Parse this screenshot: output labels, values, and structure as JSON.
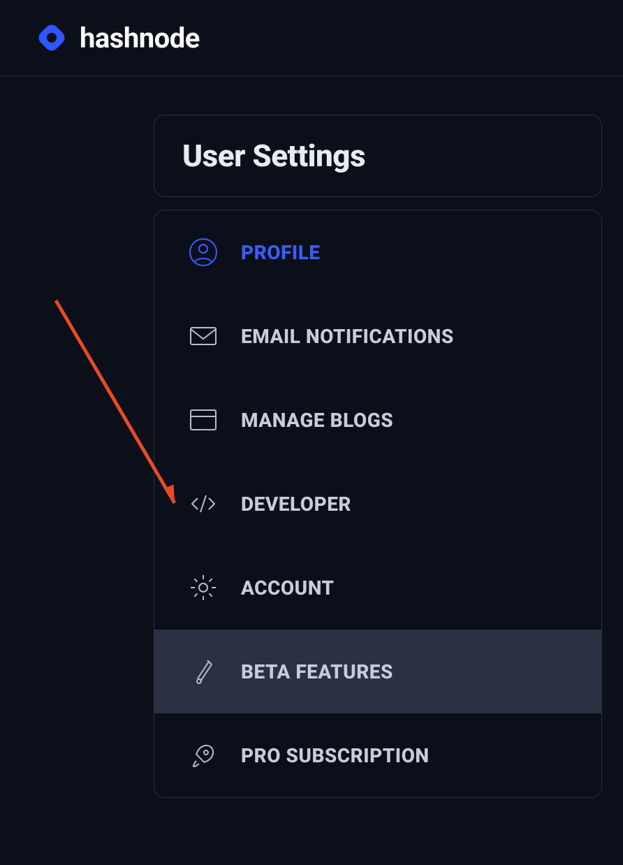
{
  "header": {
    "brand": "hashnode"
  },
  "page": {
    "title": "User Settings"
  },
  "menu": {
    "items": [
      {
        "label": "PROFILE"
      },
      {
        "label": "EMAIL NOTIFICATIONS"
      },
      {
        "label": "MANAGE BLOGS"
      },
      {
        "label": "DEVELOPER"
      },
      {
        "label": "ACCOUNT"
      },
      {
        "label": "BETA FEATURES"
      },
      {
        "label": "PRO SUBSCRIPTION"
      }
    ]
  },
  "colors": {
    "accent": "#3b5cff",
    "arrow": "#e84a27"
  }
}
